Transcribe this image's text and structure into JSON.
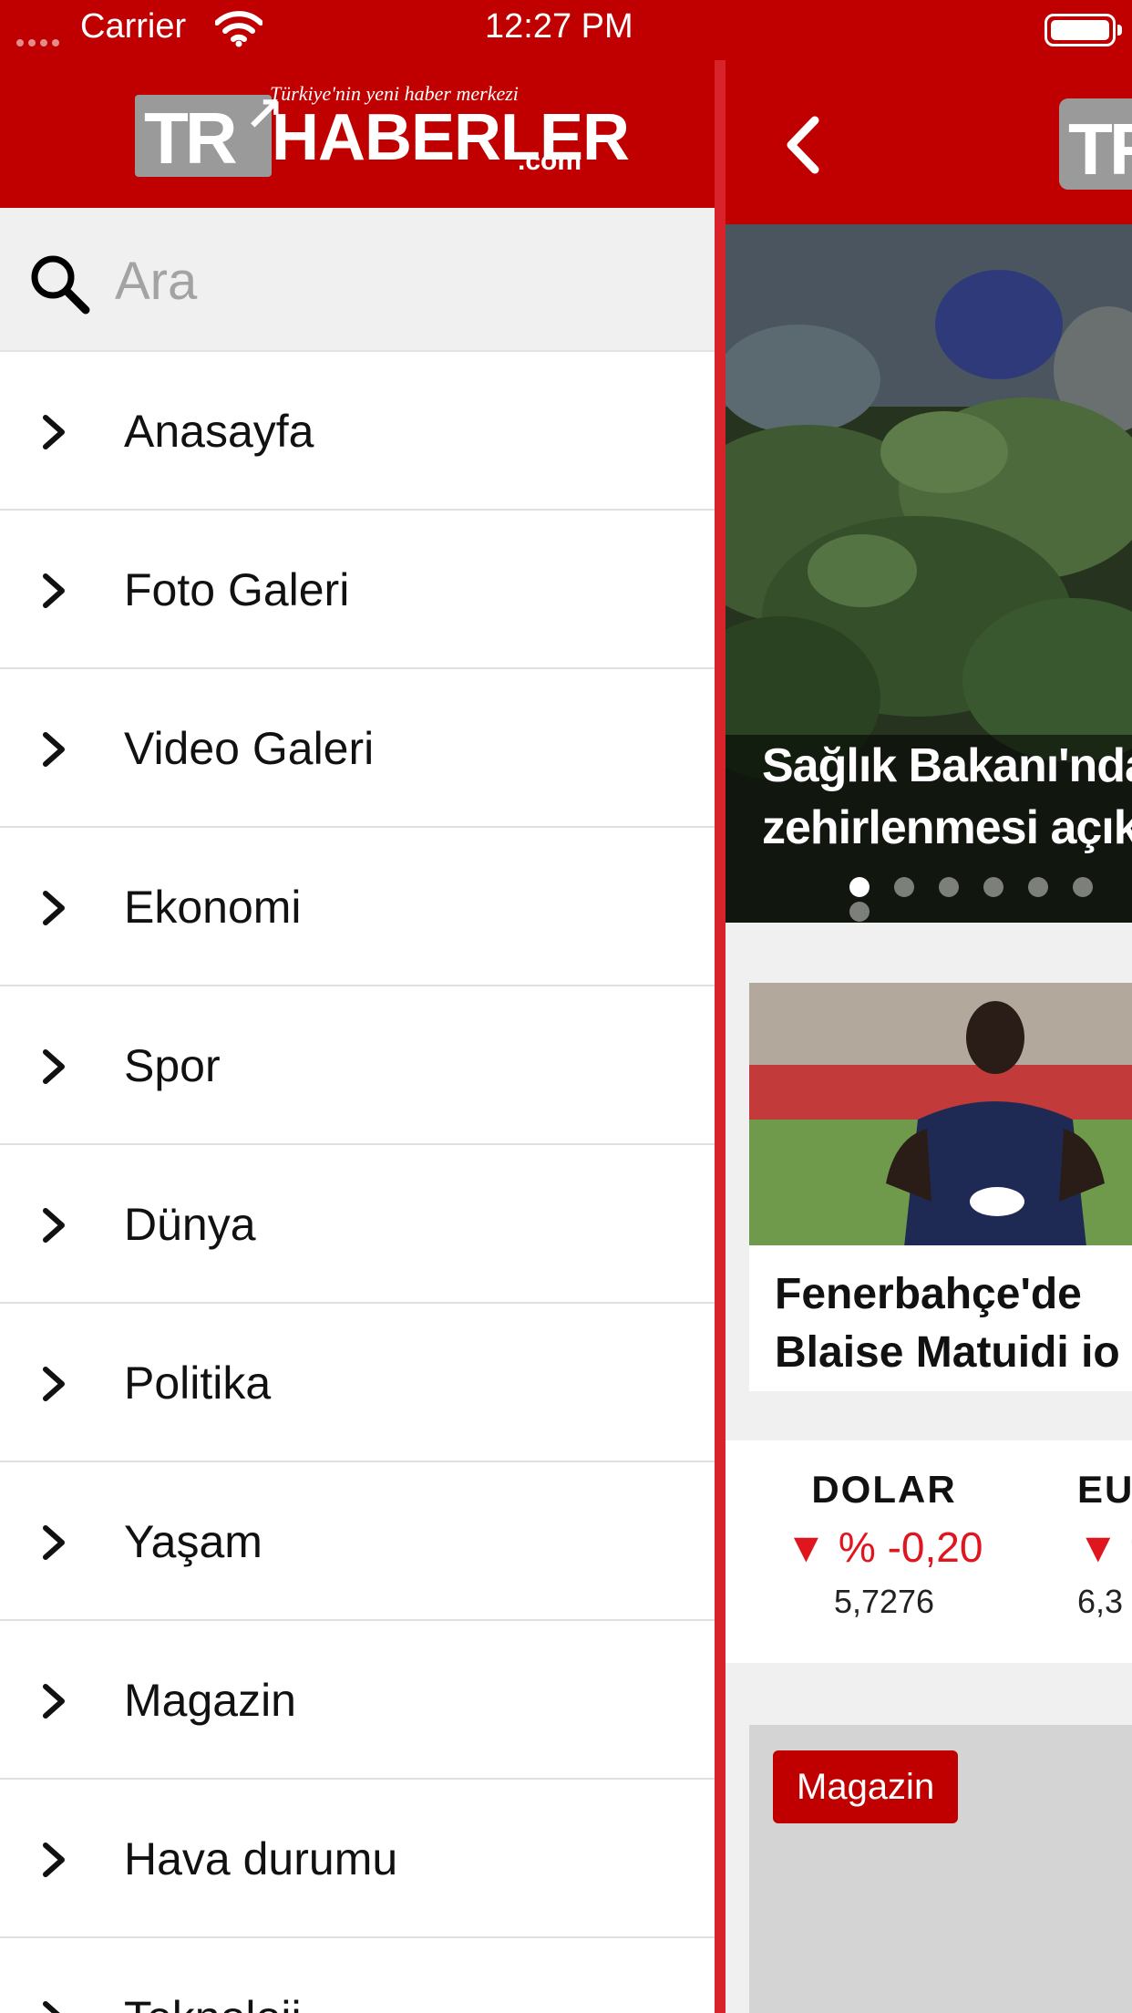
{
  "status_bar": {
    "carrier": "Carrier",
    "time": "12:27 PM"
  },
  "brand": {
    "tr": "TR",
    "name": "HABERLER",
    "suffix": ".com",
    "tagline": "Türkiye'nin yeni haber merkezi",
    "primary_color": "#c00000"
  },
  "search": {
    "placeholder": "Ara",
    "value": ""
  },
  "menu": {
    "items": [
      {
        "label": "Anasayfa"
      },
      {
        "label": "Foto Galeri"
      },
      {
        "label": "Video Galeri"
      },
      {
        "label": "Ekonomi"
      },
      {
        "label": "Spor"
      },
      {
        "label": "Dünya"
      },
      {
        "label": "Politika"
      },
      {
        "label": "Yaşam"
      },
      {
        "label": "Magazin"
      },
      {
        "label": "Hava durumu"
      },
      {
        "label": "Teknoloji"
      }
    ]
  },
  "main": {
    "slider": {
      "title_line1": "Sağlık Bakanı'nda",
      "title_line2": "zehirlenmesi açık",
      "dots_total": 7,
      "active_dot": 1
    },
    "news_card": {
      "title_line1": "Fenerbahçe'de",
      "title_line2": "Blaise Matuidi io"
    },
    "currency": {
      "dolar": {
        "name": "DOLAR",
        "change": "▼ % -0,20",
        "value": "5,7276"
      },
      "euro": {
        "name": "EU",
        "change": "▼ %",
        "value": "6,3"
      }
    },
    "story_card": {
      "category": "Magazin"
    }
  }
}
